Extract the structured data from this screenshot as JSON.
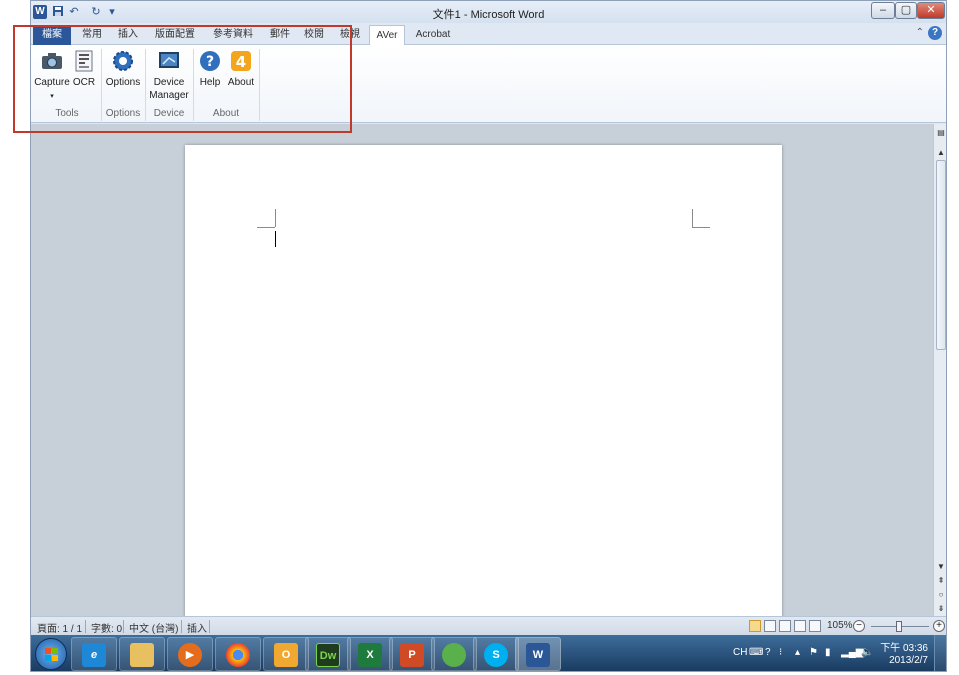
{
  "window": {
    "title": "文件1 - Microsoft Word",
    "logo_letter": "W"
  },
  "qat": {
    "save_icon": "save-icon",
    "undo_icon": "undo-icon",
    "redo_icon": "redo-icon"
  },
  "tabs": [
    {
      "label": "檔案"
    },
    {
      "label": "常用"
    },
    {
      "label": "插入"
    },
    {
      "label": "版面配置"
    },
    {
      "label": "參考資料"
    },
    {
      "label": "郵件"
    },
    {
      "label": "校閱"
    },
    {
      "label": "檢視"
    },
    {
      "label": "AVer"
    },
    {
      "label": "Acrobat"
    }
  ],
  "ribbon": {
    "capture_label": "Capture",
    "capture_arrow": "▾",
    "ocr_label": "OCR",
    "options_label": "Options",
    "device_label_1": "Device",
    "device_label_2": "Manager",
    "help_label": "Help",
    "about_label": "About",
    "groups": {
      "tools": "Tools",
      "options": "Options",
      "device": "Device",
      "about": "About"
    }
  },
  "status": {
    "page": "頁面: 1 / 1",
    "words": "字數: 0",
    "language": "中文 (台灣)",
    "mode": "插入",
    "zoom": "105%",
    "zoom_minus": "−",
    "zoom_plus": "+"
  },
  "tray": {
    "lang": "CH",
    "time": "下午 03:36",
    "date": "2013/2/7"
  },
  "taskbar": {
    "items": [
      "ie-icon",
      "explorer-icon",
      "media-player-icon",
      "chrome-icon",
      "outlook-icon",
      "dreamweaver-icon",
      "excel-icon",
      "powerpoint-icon",
      "messenger-icon",
      "skype-icon",
      "word-icon"
    ],
    "dreamweaver_text": "Dw",
    "skype_text": "S",
    "word_text": "W",
    "excel_text": "X",
    "powerpoint_text": "P",
    "outlook_text": "O"
  },
  "colors": {
    "file_tab": "#2b579a",
    "highlight": "#c0392b",
    "taskbar": "#1f4a77"
  }
}
